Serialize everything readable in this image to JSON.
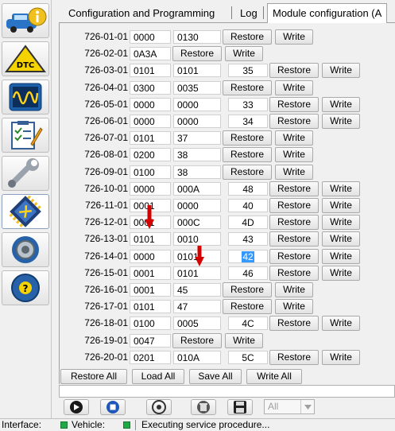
{
  "tabs": [
    {
      "label": "Configuration and Programming"
    },
    {
      "label": "Log"
    },
    {
      "label": "Module configuration (A"
    }
  ],
  "rail_icons": [
    "info-car-icon",
    "dtc-icon",
    "oscilloscope-icon",
    "checklist-icon",
    "wrench-icon",
    "chip-module-icon",
    "gear-wheel-icon",
    "steering-help-icon"
  ],
  "buttons": {
    "restore": "Restore",
    "write": "Write"
  },
  "rows": [
    {
      "code": "726-01-01",
      "fields": [
        "0000",
        "0130"
      ]
    },
    {
      "code": "726-02-01",
      "fields": [
        "0A3A"
      ]
    },
    {
      "code": "726-03-01",
      "fields": [
        "0101",
        "0101",
        "35"
      ]
    },
    {
      "code": "726-04-01",
      "fields": [
        "0300",
        "0035"
      ]
    },
    {
      "code": "726-05-01",
      "fields": [
        "0000",
        "0000",
        "33"
      ]
    },
    {
      "code": "726-06-01",
      "fields": [
        "0000",
        "0000",
        "34"
      ]
    },
    {
      "code": "726-07-01",
      "fields": [
        "0101",
        "37"
      ]
    },
    {
      "code": "726-08-01",
      "fields": [
        "0200",
        "38"
      ]
    },
    {
      "code": "726-09-01",
      "fields": [
        "0100",
        "38"
      ]
    },
    {
      "code": "726-10-01",
      "fields": [
        "0000",
        "000A",
        "48"
      ]
    },
    {
      "code": "726-11-01",
      "fields": [
        "0001",
        "0000",
        "40"
      ]
    },
    {
      "code": "726-12-01",
      "fields": [
        "0001",
        "000C",
        "4D"
      ]
    },
    {
      "code": "726-13-01",
      "fields": [
        "0101",
        "0010",
        "43"
      ]
    },
    {
      "code": "726-14-01",
      "fields": [
        "0000",
        "0101",
        "42"
      ]
    },
    {
      "code": "726-15-01",
      "fields": [
        "0001",
        "0101",
        "46"
      ]
    },
    {
      "code": "726-16-01",
      "fields": [
        "0001",
        "45"
      ]
    },
    {
      "code": "726-17-01",
      "fields": [
        "0101",
        "47"
      ]
    },
    {
      "code": "726-18-01",
      "fields": [
        "0100",
        "0005",
        "4C"
      ]
    },
    {
      "code": "726-19-01",
      "fields": [
        "0047"
      ]
    },
    {
      "code": "726-20-01",
      "fields": [
        "0201",
        "010A",
        "5C"
      ]
    }
  ],
  "bulk_actions": [
    "Restore All",
    "Load All",
    "Save All",
    "Write All"
  ],
  "toolbar_icons": [
    "play-icon",
    "stop-icon",
    "diagnose-icon",
    "delete-icon",
    "save-disk-icon"
  ],
  "filter_select": {
    "value": "All"
  },
  "status": {
    "interface_label": "Interface:",
    "vehicle_label": "Vehicle:",
    "message": "Executing service procedure..."
  },
  "colors": {
    "accent_selection": "#3399ff",
    "arrow": "#d40000",
    "status_ok": "#21a947"
  }
}
